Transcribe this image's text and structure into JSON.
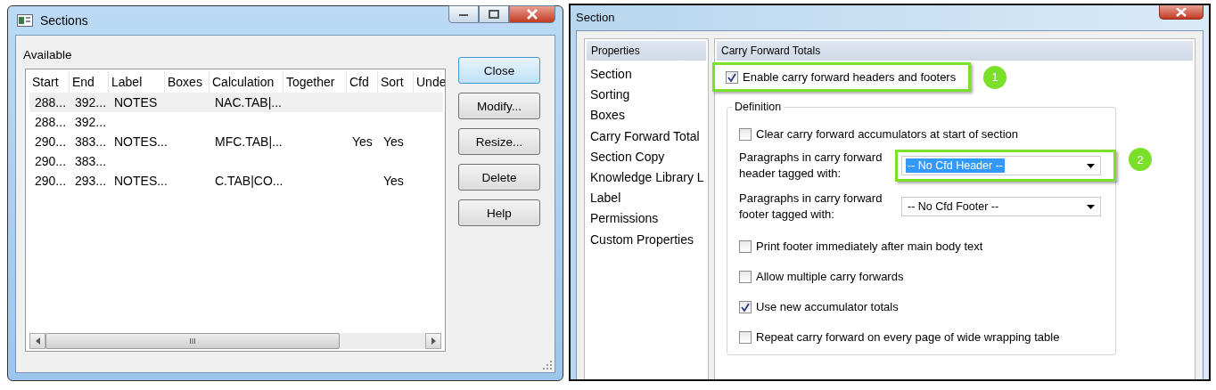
{
  "sections_window": {
    "title": "Sections",
    "available_label": "Available",
    "columns": [
      "Start",
      "End",
      "Label",
      "Boxes",
      "Calculation",
      "Together",
      "Cfd",
      "Sort",
      "Unde"
    ],
    "rows": [
      {
        "selected": true,
        "cells": [
          "288...",
          "392...",
          "NOTES",
          "",
          "NAC.TAB|...",
          "",
          "",
          "",
          ""
        ]
      },
      {
        "selected": false,
        "cells": [
          "288...",
          "392...",
          "",
          "",
          "",
          "",
          "",
          "",
          ""
        ]
      },
      {
        "selected": false,
        "cells": [
          "290...",
          "383...",
          "NOTES...",
          "",
          "MFC.TAB|...",
          "",
          "Yes",
          "Yes",
          ""
        ]
      },
      {
        "selected": false,
        "cells": [
          "290...",
          "383...",
          "",
          "",
          "",
          "",
          "",
          "",
          ""
        ]
      },
      {
        "selected": false,
        "cells": [
          "290...",
          "293...",
          "NOTES...",
          "",
          "C.TAB|CO...",
          "",
          "",
          "Yes",
          ""
        ]
      }
    ],
    "scrollbar_grip": "III",
    "buttons": [
      {
        "label": "Close",
        "default": true
      },
      {
        "label": "Modify...",
        "default": false
      },
      {
        "label": "Resize...",
        "default": false
      },
      {
        "label": "Delete",
        "default": false
      },
      {
        "label": "Help",
        "default": false
      }
    ]
  },
  "section_window": {
    "title": "Section",
    "nav": {
      "header": "Properties",
      "items": [
        "Section",
        "Sorting",
        "Boxes",
        "Carry Forward Total",
        "Section Copy",
        "Knowledge Library L",
        "Label",
        "Permissions",
        "Custom Properties"
      ]
    },
    "panel": {
      "header": "Carry Forward Totals",
      "enable": {
        "label": "Enable carry forward headers and footers",
        "checked": true,
        "callout": "1"
      },
      "definition": {
        "legend": "Definition",
        "rows": [
          {
            "kind": "checkbox",
            "label": "Clear carry forward accumulators at start of section",
            "checked": false
          },
          {
            "kind": "dropdown",
            "label": "Paragraphs in carry forward header tagged with:",
            "value": "-- No Cfd Header --",
            "highlighted": true,
            "callout": "2"
          },
          {
            "kind": "dropdown",
            "label": "Paragraphs in carry forward footer tagged with:",
            "value": "-- No Cfd Footer --",
            "highlighted": false
          },
          {
            "kind": "checkbox",
            "label": "Print footer immediately after main body text",
            "checked": false
          },
          {
            "kind": "checkbox",
            "label": "Allow multiple carry forwards",
            "checked": false
          },
          {
            "kind": "checkbox",
            "label": "Use new accumulator totals",
            "checked": true
          },
          {
            "kind": "checkbox",
            "label": "Repeat carry forward on every page of wide wrapping table",
            "checked": false
          }
        ]
      }
    }
  }
}
